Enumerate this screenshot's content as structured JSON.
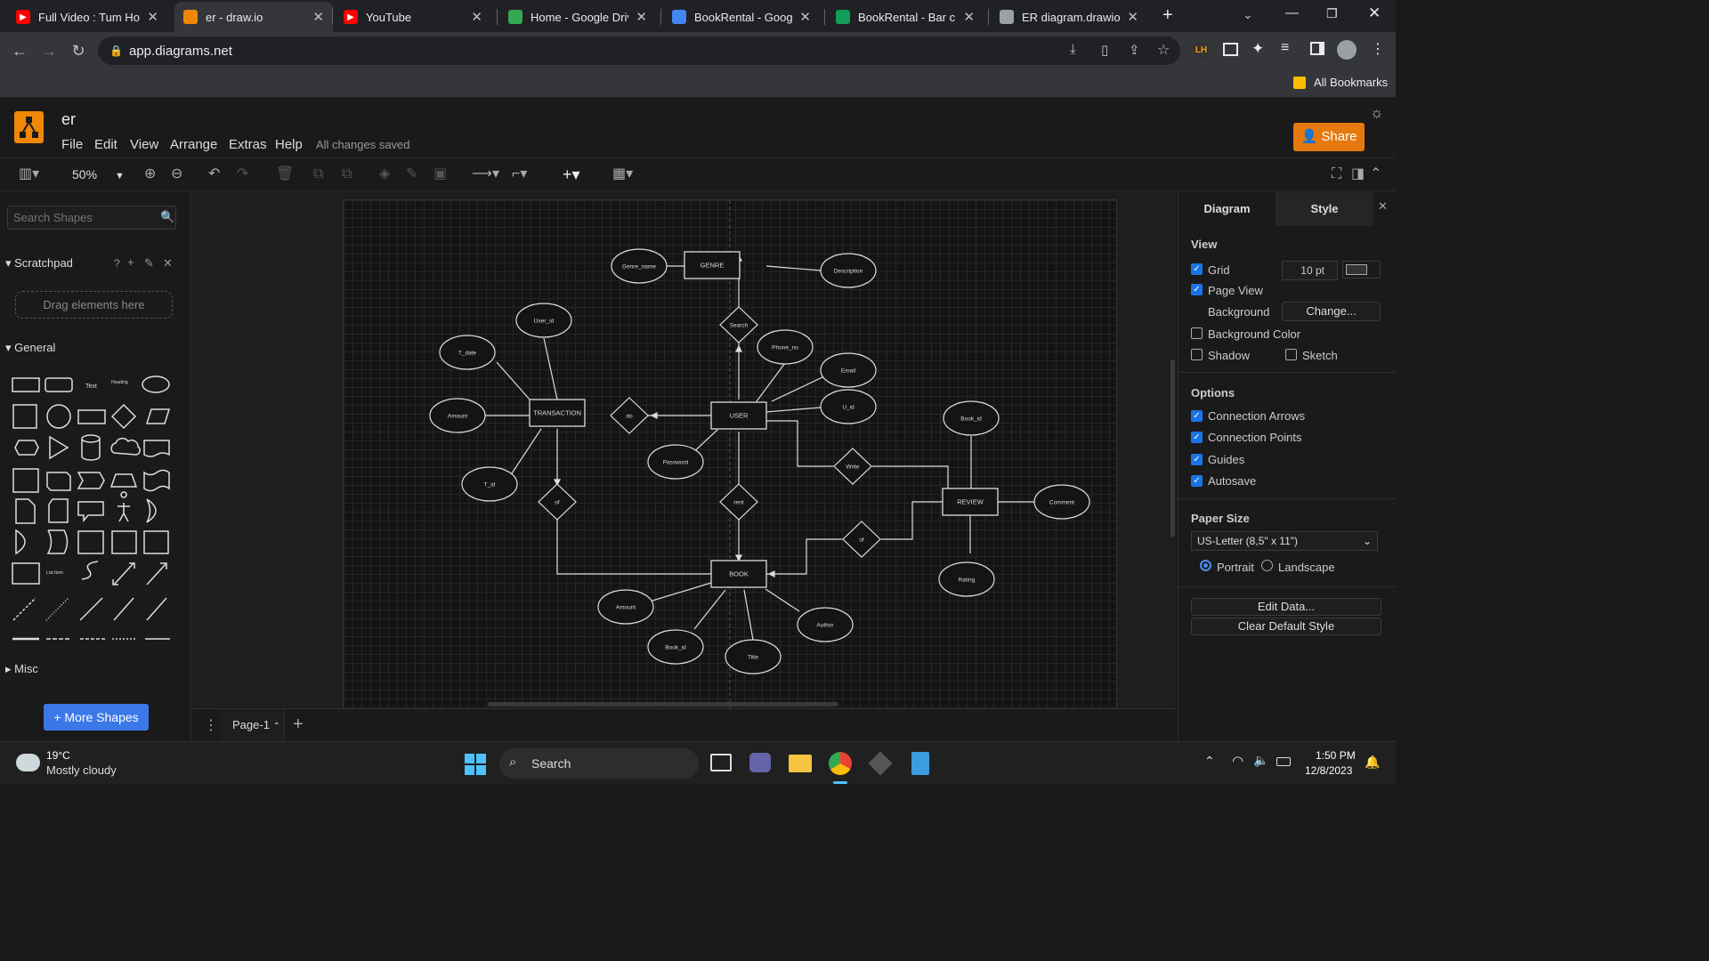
{
  "browser": {
    "tabs": [
      {
        "label": "Full Video : Tum Ho T",
        "icon": "youtube-icon",
        "color": "#ff0000"
      },
      {
        "label": "er - draw.io",
        "icon": "drawio-icon",
        "color": "#f08705"
      },
      {
        "label": "YouTube",
        "icon": "youtube-icon",
        "color": "#ff0000"
      },
      {
        "label": "Home - Google Drive",
        "icon": "google-drive-icon",
        "color": "#34a853"
      },
      {
        "label": "BookRental - Google",
        "icon": "google-docs-icon",
        "color": "#4285f4"
      },
      {
        "label": "BookRental - Bar cha",
        "icon": "google-sheets-icon",
        "color": "#0f9d58"
      },
      {
        "label": "ER diagram.drawio",
        "icon": "globe-icon",
        "color": "#9aa0a6"
      }
    ],
    "url": "app.diagrams.net",
    "bookmarks_label": "All Bookmarks"
  },
  "app": {
    "title": "er",
    "menus": [
      "File",
      "Edit",
      "View",
      "Arrange",
      "Extras",
      "Help"
    ],
    "save_status": "All changes saved",
    "share_label": "Share",
    "zoom": "50%"
  },
  "left_panel": {
    "search_placeholder": "Search Shapes",
    "scratchpad_title": "Scratchpad",
    "scratchpad_help": "?",
    "drag_hint": "Drag elements here",
    "general_title": "General",
    "misc_title": "Misc",
    "more_shapes": "+ More Shapes",
    "shape_text_label": "Text",
    "shape_heading_label": "Heading",
    "shape_list_label": "List Item"
  },
  "diagram": {
    "entities": [
      "GENRE",
      "TRANSACTION",
      "USER",
      "REVIEW",
      "BOOK"
    ],
    "attributes": [
      "Genre_name",
      "Description",
      "User_id",
      "T_date",
      "Phone_no",
      "Email",
      "Amount",
      "U_id",
      "Book_id",
      "Password",
      "T_id",
      "Comment",
      "Rating",
      "Amount",
      "Author",
      "Book_id",
      "Title"
    ],
    "relationships": [
      "Search",
      "do",
      "Write",
      "of",
      "rent",
      "of"
    ]
  },
  "right_panel": {
    "tabs": [
      "Diagram",
      "Style"
    ],
    "view_title": "View",
    "grid_label": "Grid",
    "grid_size": "10 pt",
    "page_view_label": "Page View",
    "background_label": "Background",
    "change_label": "Change...",
    "background_color_label": "Background Color",
    "shadow_label": "Shadow",
    "sketch_label": "Sketch",
    "options_title": "Options",
    "connection_arrows": "Connection Arrows",
    "connection_points": "Connection Points",
    "guides": "Guides",
    "autosave": "Autosave",
    "paper_size_title": "Paper Size",
    "paper_size": "US-Letter (8,5\" x 11\")",
    "portrait": "Portrait",
    "landscape": "Landscape",
    "edit_data": "Edit Data...",
    "clear_default_style": "Clear Default Style"
  },
  "pages": {
    "current": "Page-1"
  },
  "taskbar": {
    "temperature": "19°C",
    "weather": "Mostly cloudy",
    "search": "Search",
    "time": "1:50 PM",
    "date": "12/8/2023"
  }
}
